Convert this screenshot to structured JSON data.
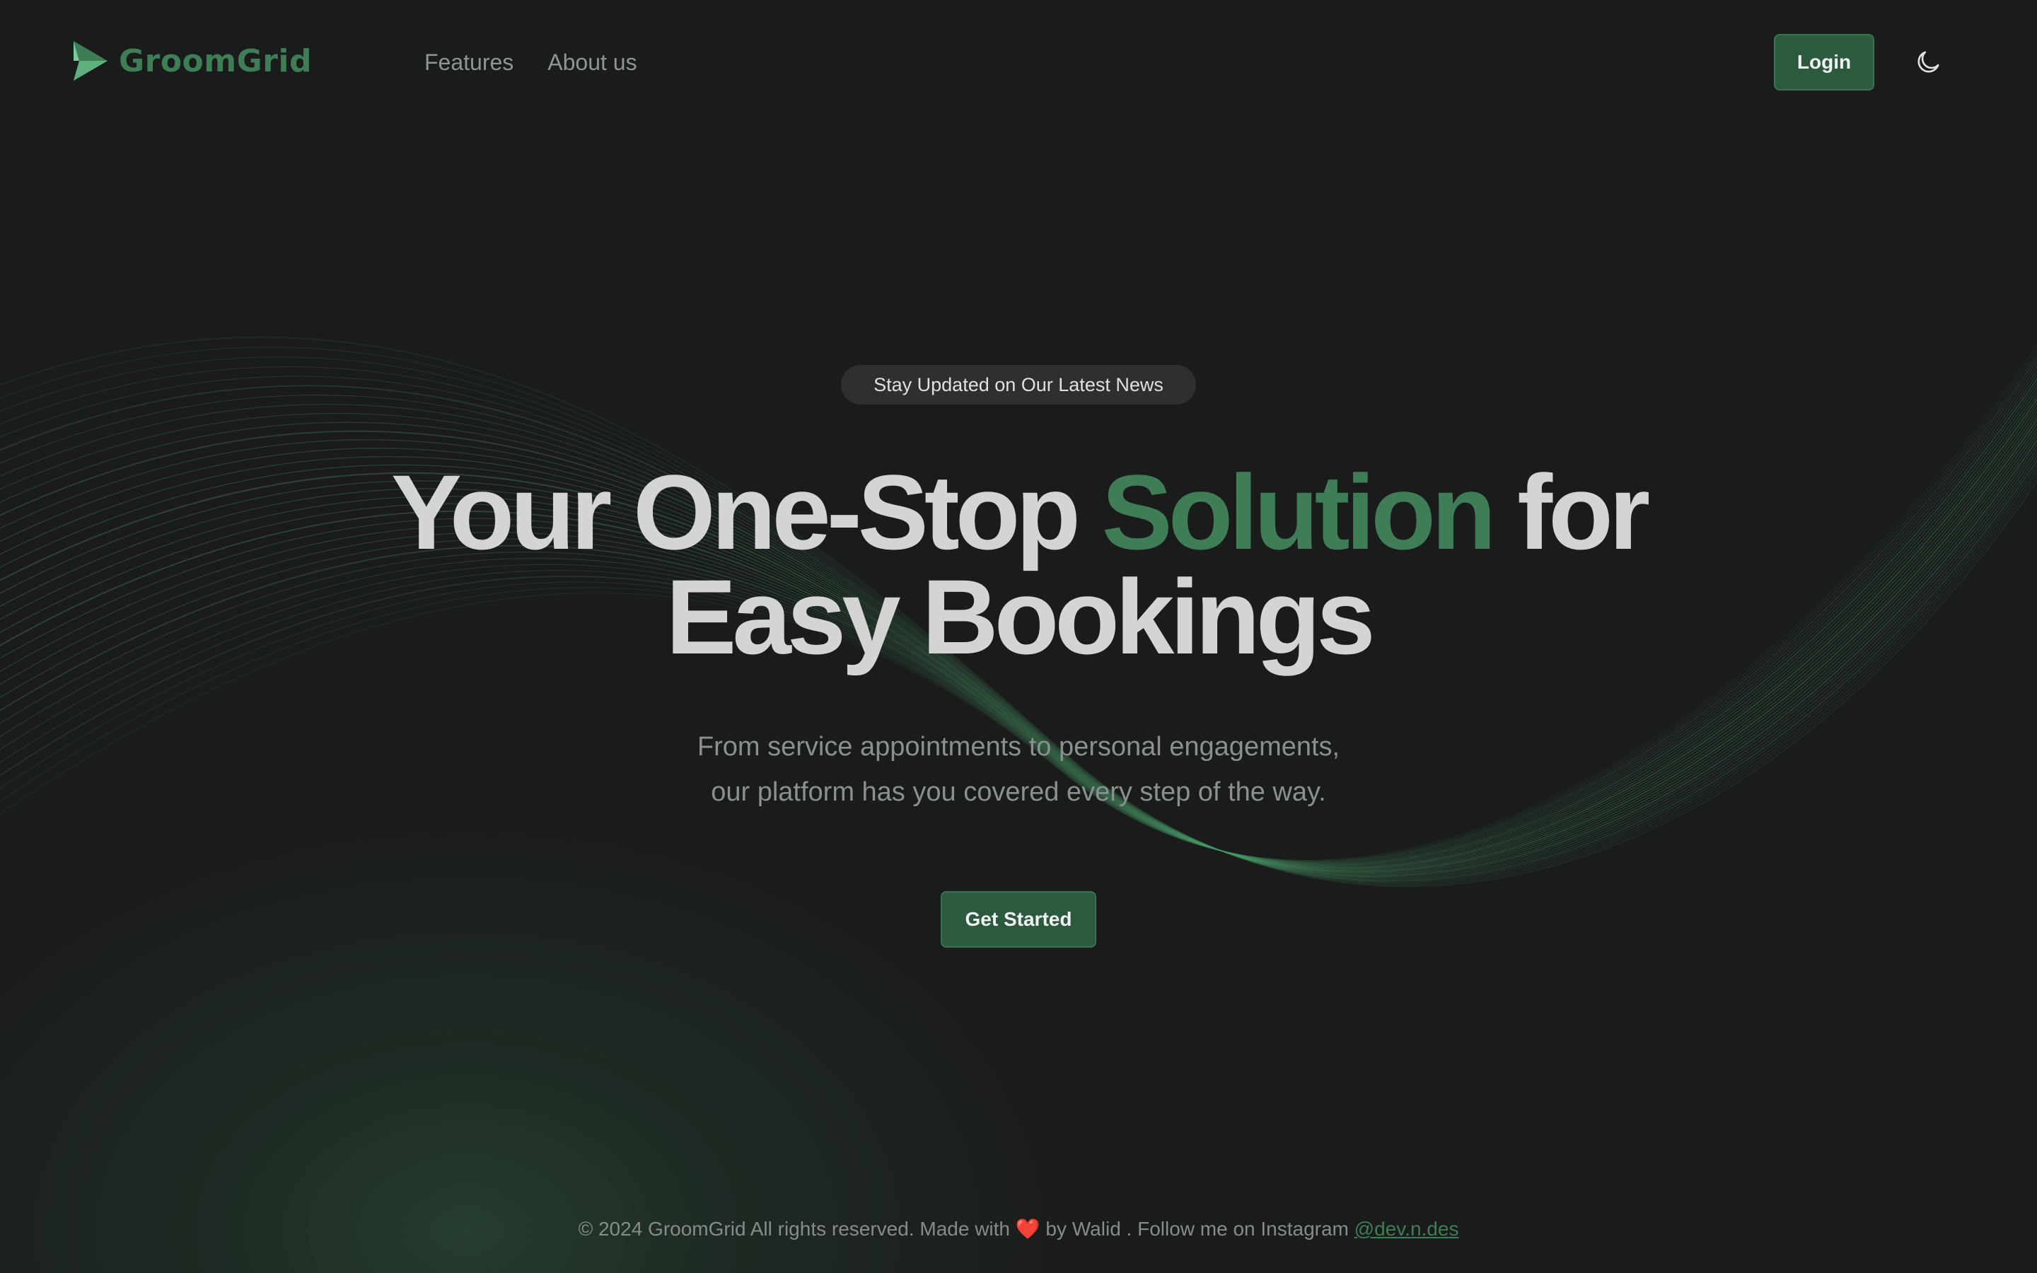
{
  "header": {
    "brand": "GroomGrid",
    "nav": [
      {
        "label": "Features"
      },
      {
        "label": "About us"
      }
    ],
    "login_label": "Login",
    "theme_icon": "moon-icon"
  },
  "hero": {
    "badge": "Stay Updated on Our Latest News",
    "headline": {
      "part1": "Your One-Stop ",
      "accent": "Solution",
      "part2": " for",
      "line2": "Easy Bookings"
    },
    "subtitle": {
      "line1": "From service appointments to personal engagements,",
      "line2": "our platform has you covered every step of the way."
    },
    "cta_label": "Get Started"
  },
  "footer": {
    "prefix": "© 2024 GroomGrid All rights reserved. Made with ",
    "heart": "❤️",
    "middle": " by Walid . Follow me on Instagram ",
    "instagram_handle": "@dev.n.des"
  },
  "colors": {
    "background": "#1a1b1b",
    "accent": "#3f7d57",
    "button": "#2c5a3e",
    "heading": "#d3d4d3",
    "muted_text": "#8a908e"
  }
}
